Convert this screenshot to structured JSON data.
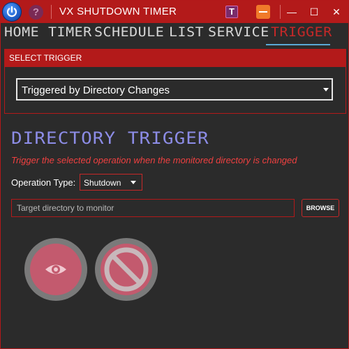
{
  "titlebar": {
    "title": "VX SHUTDOWN TIMER",
    "icons": [
      "power-app-icon",
      "help-icon",
      "t-icon",
      "orange-minus-icon",
      "minimize-icon",
      "maximize-icon",
      "close-icon"
    ],
    "help_glyph": "?",
    "t_glyph": "T",
    "minimize_glyph": "—",
    "maximize_glyph": "☐",
    "close_glyph": "✕"
  },
  "tabs": [
    {
      "label": "HOME"
    },
    {
      "label": "TIMER"
    },
    {
      "label": "SCHEDULE"
    },
    {
      "label": "LIST"
    },
    {
      "label": "SERVICE"
    },
    {
      "label": "TRIGGER",
      "active": true
    }
  ],
  "trigger_panel": {
    "header": "SELECT TRIGGER",
    "selected": "Triggered by Directory Changes"
  },
  "section": {
    "title": "DIRECTORY TRIGGER",
    "description": "Trigger the selected operation when the monitored directory is changed"
  },
  "operation": {
    "label": "Operation Type:",
    "selected": "Shutdown"
  },
  "directory": {
    "placeholder": "Target directory to monitor",
    "value": "",
    "browse_label": "BROWSE"
  },
  "actions": {
    "icons": [
      "eye-icon",
      "cancel-icon"
    ]
  },
  "colors": {
    "accent_red": "#b31a1a",
    "active_tab": "#c62828",
    "section_title": "#8c8ce6",
    "description": "#ef4040",
    "background": "#2b2b2b",
    "tab_underline": "#5aa9d6"
  }
}
